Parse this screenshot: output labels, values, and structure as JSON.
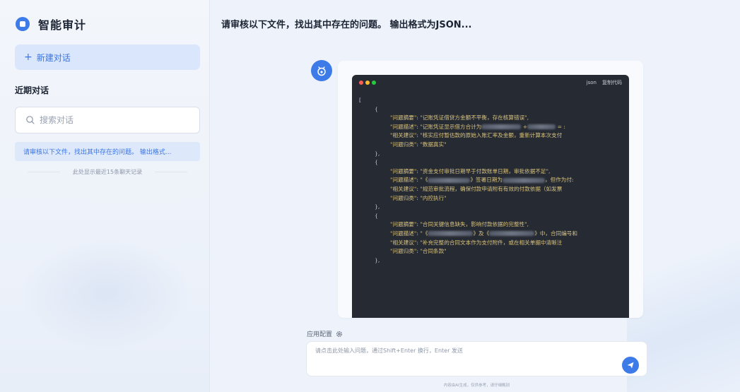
{
  "sidebar": {
    "brand_title": "智能审计",
    "new_chat_label": "新建对话",
    "recent_title": "近期对话",
    "search_placeholder": "搜索对话",
    "history_items": [
      "请审核以下文件，找出其中存在的问题。 输出格式..."
    ],
    "history_note": "此处显示最近15条聊天记录"
  },
  "main": {
    "conversation_title": "请审核以下文件，找出其中存在的问题。 输出格式为JSON...",
    "code_block": {
      "language": "json",
      "copy_label": "复制代码",
      "lines": [
        {
          "type": "plain",
          "indent": 0,
          "text": "["
        },
        {
          "type": "plain",
          "indent": 1,
          "text": "{"
        },
        {
          "type": "kv",
          "indent": 2,
          "key": "\"问题摘要\"",
          "value": "\"记账凭证借贷方金额不平衡，存在核算错误\","
        },
        {
          "type": "kv",
          "indent": 2,
          "key": "\"问题描述\"",
          "value": "\"记账凭证显示借方合计为",
          "blurs": [
            56
          ],
          "tail": " +",
          "blurs2": [
            40
          ],
          "tail2": " = :"
        },
        {
          "type": "kv",
          "indent": 2,
          "key": "\"相关建议\"",
          "value": "\"核实应付暂估款的原始入账汇率及金额，重新计算本次支付"
        },
        {
          "type": "kv",
          "indent": 2,
          "key": "\"问题归类\"",
          "value": "\"数据真实\""
        },
        {
          "type": "plain",
          "indent": 1,
          "text": "},"
        },
        {
          "type": "plain",
          "indent": 1,
          "text": "{"
        },
        {
          "type": "kv",
          "indent": 2,
          "key": "\"问题摘要\"",
          "value": "\"资金支付审批日期早于付款账单日期，审批依据不足\","
        },
        {
          "type": "kv",
          "indent": 2,
          "key": "\"问题描述\"",
          "value": "\"《",
          "blurs": [
            60
          ],
          "tail": "》签署日期为",
          "blurs2": [
            60
          ],
          "tail2": "，但作为付:"
        },
        {
          "type": "kv",
          "indent": 2,
          "key": "\"相关建议\"",
          "value": "\"规范审批流程，确保付款申请附有有效的付款依据（如发票"
        },
        {
          "type": "kv",
          "indent": 2,
          "key": "\"问题归类\"",
          "value": "\"内控执行\""
        },
        {
          "type": "plain",
          "indent": 1,
          "text": "},"
        },
        {
          "type": "plain",
          "indent": 1,
          "text": "{"
        },
        {
          "type": "kv",
          "indent": 2,
          "key": "\"问题摘要\"",
          "value": "\"合同关键信息缺失，影响付款依据的完整性\","
        },
        {
          "type": "kv",
          "indent": 2,
          "key": "\"问题描述\"",
          "value": "\"《",
          "blurs": [
            64
          ],
          "tail": "》及《",
          "blurs2": [
            64
          ],
          "tail2": "》中，合同编号和"
        },
        {
          "type": "kv",
          "indent": 2,
          "key": "\"相关建议\"",
          "value": "\"补充完整的合同文本作为支付附件，或在相关单据中清晰注"
        },
        {
          "type": "kv",
          "indent": 2,
          "key": "\"问题归类\"",
          "value": "\"合同条款\""
        },
        {
          "type": "plain",
          "indent": 1,
          "text": "},"
        }
      ]
    },
    "app_config_label": "应用配置",
    "input_placeholder": "请点击此处输入问题，通过Shift+Enter 换行，Enter 发送",
    "footer_note": "内容由AI生成，仅供参考，请仔细甄别"
  },
  "colors": {
    "accent": "#3c7be8",
    "code_bg": "#262a33",
    "code_string": "#d9c37e",
    "dot_red": "#ff5f56",
    "dot_yellow": "#ffbd2e",
    "dot_green": "#27c93f"
  },
  "icons": {
    "brand": "brand-logo-icon",
    "new_chat": "plus-icon",
    "search": "search-icon",
    "bot": "bot-avatar-icon",
    "config": "gear-icon",
    "send": "send-icon"
  }
}
